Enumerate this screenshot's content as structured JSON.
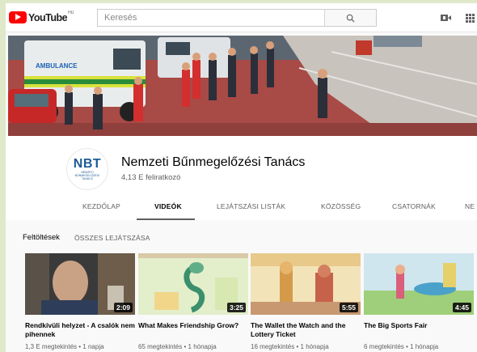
{
  "masthead": {
    "logo_text": "YouTube",
    "logo_region": "HU",
    "search_placeholder": "Keresés"
  },
  "channel": {
    "avatar_mark": "NBT",
    "avatar_sub": "NEMZETI BŰNMEGELŐZÉSI TANÁCS",
    "name": "Nemzeti Bűnmegelőzési Tanács",
    "subscribers": "4,13 E feliratkozó"
  },
  "banner": {
    "vehicle_label": "AMBULANCE"
  },
  "tabs": [
    {
      "label": "KEZDŐLAP",
      "active": false
    },
    {
      "label": "VIDEÓK",
      "active": true
    },
    {
      "label": "LEJÁTSZÁSI LISTÁK",
      "active": false
    },
    {
      "label": "KÖZÖSSÉG",
      "active": false
    },
    {
      "label": "CSATORNÁK",
      "active": false
    },
    {
      "label": "NE",
      "active": false
    }
  ],
  "section": {
    "title": "Feltöltések",
    "link": "ÖSSZES LEJÁTSZÁSA"
  },
  "videos": [
    {
      "title": "Rendkívüli helyzet - A csalók nem pihennek",
      "duration": "2:09",
      "views": "1,3 E megtekintés",
      "age": "1 napja"
    },
    {
      "title": "What Makes Friendship Grow?",
      "duration": "3:25",
      "views": "65 megtekintés",
      "age": "1 hónapja"
    },
    {
      "title": "The Wallet the Watch and the Lottery Ticket",
      "duration": "5:55",
      "views": "16 megtekintés",
      "age": "1 hónapja"
    },
    {
      "title": "The Big Sports Fair",
      "duration": "4:45",
      "views": "6 megtekintés",
      "age": "1 hónapja"
    }
  ],
  "colors": {
    "brand_red": "#ff0000",
    "outer_background": "#dfe8c9",
    "page_background": "#f9f9f9"
  }
}
